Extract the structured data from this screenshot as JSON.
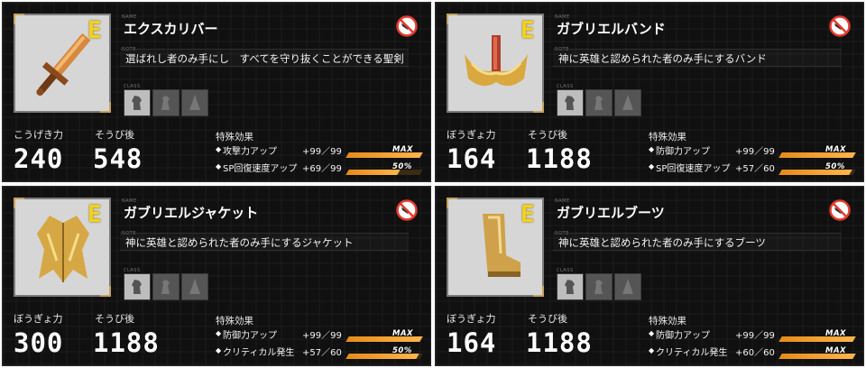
{
  "labels": {
    "name_tag": "NAME",
    "note_tag": "NOTE",
    "class_tag": "CLASS",
    "effect_title": "特殊効果",
    "after_equip": "そうび後"
  },
  "colors": {
    "rank": "#f3d21d",
    "bar_fill": "#ff9f2e",
    "bar_bg": "#3b2a14",
    "card_bg": "#101010"
  },
  "cards": [
    {
      "icon": "sword-icon",
      "rank": "E",
      "name": "エクスカリバー",
      "note": "選ばれし者のみ手にし　すべてを守り抜くことができる聖剣",
      "stat_label": "こうげき力",
      "stat_value": "240",
      "after_value": "548",
      "effects": [
        {
          "label": "攻撃力アップ",
          "value": "+99／99",
          "badge": "MAX",
          "level": 1.0
        },
        {
          "label": "SP回復速度アップ",
          "value": "+69／99",
          "badge": "50%",
          "level": 0.7
        }
      ]
    },
    {
      "icon": "headband-icon",
      "rank": "E",
      "name": "ガブリエルバンド",
      "note": "神に英雄と認められた者のみ手にするバンド",
      "stat_label": "ぼうぎょ力",
      "stat_value": "164",
      "after_value": "1188",
      "effects": [
        {
          "label": "防御力アップ",
          "value": "+99／99",
          "badge": "MAX",
          "level": 1.0
        },
        {
          "label": "SP回復速度アップ",
          "value": "+57／60",
          "badge": "50%",
          "level": 0.95
        }
      ]
    },
    {
      "icon": "jacket-icon",
      "rank": "E",
      "name": "ガブリエルジャケット",
      "note": "神に英雄と認められた者のみ手にするジャケット",
      "stat_label": "ぼうぎょ力",
      "stat_value": "300",
      "after_value": "1188",
      "effects": [
        {
          "label": "防御力アップ",
          "value": "+99／99",
          "badge": "MAX",
          "level": 1.0
        },
        {
          "label": "クリティカル発生",
          "value": "+57／60",
          "badge": "50%",
          "level": 0.95
        }
      ]
    },
    {
      "icon": "boots-icon",
      "rank": "E",
      "name": "ガブリエルブーツ",
      "note": "神に英雄と認められた者のみ手にするブーツ",
      "stat_label": "ぼうぎょ力",
      "stat_value": "164",
      "after_value": "1188",
      "effects": [
        {
          "label": "防御力アップ",
          "value": "+99／99",
          "badge": "MAX",
          "level": 1.0
        },
        {
          "label": "クリティカル発生",
          "value": "+60／60",
          "badge": "MAX",
          "level": 1.0
        }
      ]
    }
  ]
}
